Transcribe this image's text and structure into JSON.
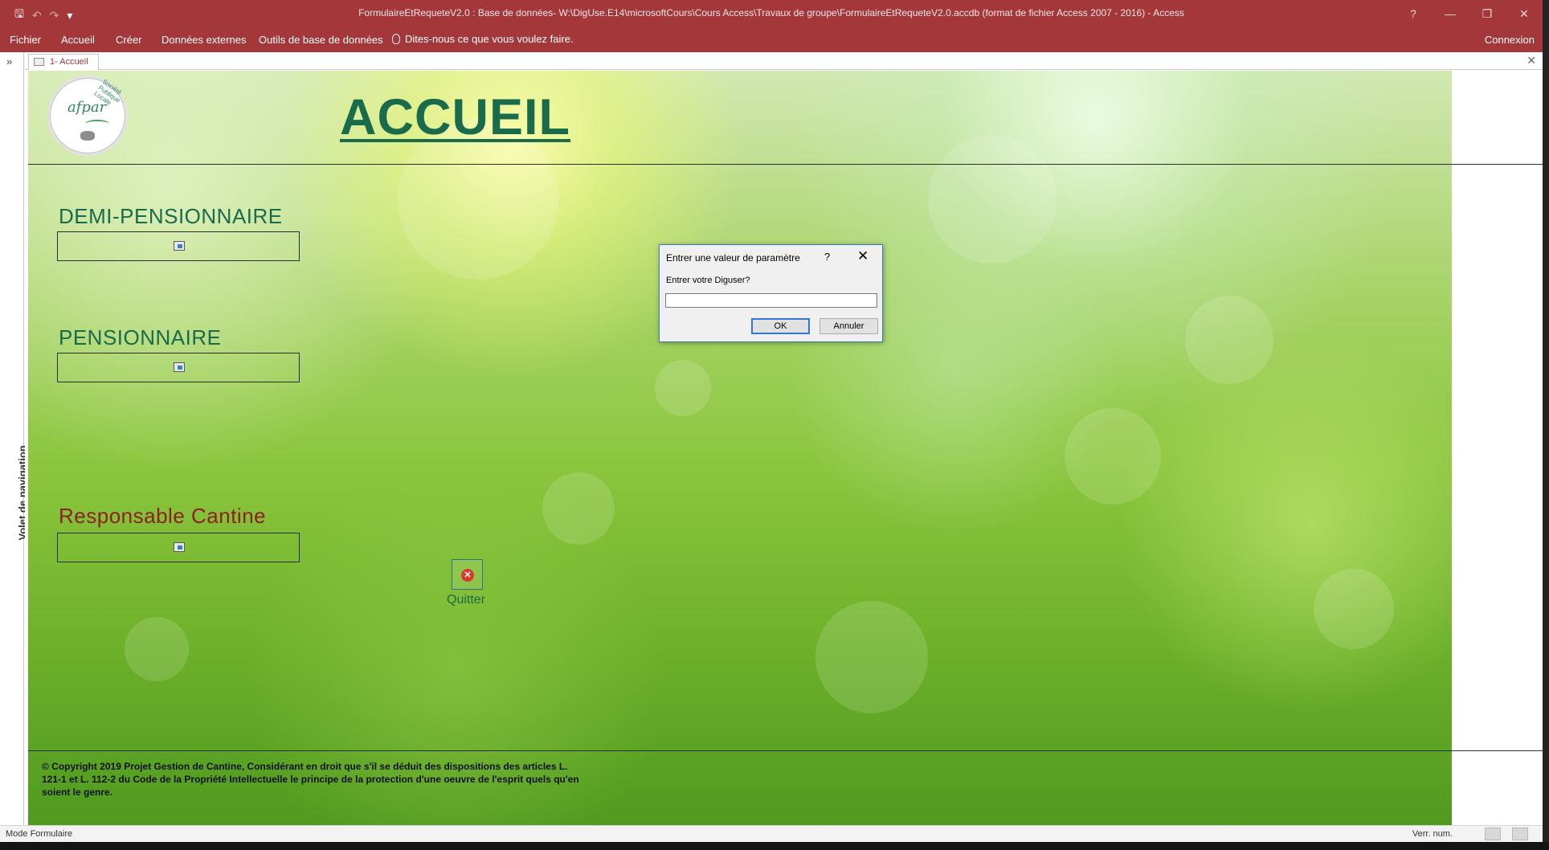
{
  "window": {
    "title": "FormulaireEtRequeteV2.0 : Base de données- W:\\DigUse.E14\\microsoftCours\\Cours Access\\Travaux de groupe\\FormulaireEtRequeteV2.0.accdb (format de fichier Access 2007 - 2016) - Access",
    "controls": [
      "?",
      "—",
      "❐",
      "✕"
    ]
  },
  "qat": {
    "save_icon": "save-icon",
    "undo_icon": "undo-icon",
    "redo_icon": "redo-icon",
    "customize": "▾"
  },
  "ribbon": {
    "tabs": [
      "Fichier",
      "Accueil",
      "Créer",
      "Données externes",
      "Outils de base de données"
    ],
    "tell_me": "Dites-nous ce que vous voulez faire.",
    "account": "Connexion"
  },
  "nav_pane": {
    "label": "Volet de navigation",
    "shutter": "»"
  },
  "document_tab": {
    "label": "1- Accueil",
    "close": "✕"
  },
  "form": {
    "title": "ACCUEIL",
    "logo": {
      "text": "afpar",
      "arc_text": "Société Publique Locale"
    },
    "sections": [
      {
        "title": "DEMI-PENSIONNAIRE"
      },
      {
        "title": "PENSIONNAIRE"
      },
      {
        "title": "Responsable Cantine"
      }
    ],
    "quit_label": "Quitter",
    "copyright": "© Copyright 2019 Projet Gestion de Cantine, Considérant en droit que s'il se déduit des dispositions des articles L. 121-1 et L. 112-2 du Code de la Propriété Intellectuelle le principe de la protection d'une oeuvre de l'esprit quels qu'en soient le genre."
  },
  "dialog": {
    "title": "Entrer une valeur de paramètre",
    "help": "?",
    "close": "✕",
    "prompt": "Entrer votre Diguser?",
    "input_value": "",
    "ok_label": "OK",
    "cancel_label": "Annuler"
  },
  "status_bar": {
    "mode": "Mode Formulaire",
    "numlock": "Verr. num."
  },
  "colors": {
    "accent": "#a4373a",
    "form_title": "#1a6b4c",
    "section_red": "#8e1f1f"
  }
}
